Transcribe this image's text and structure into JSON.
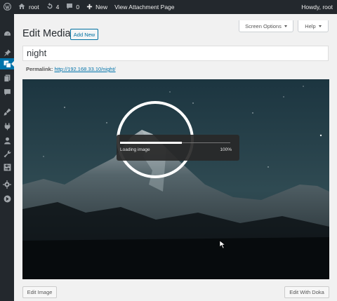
{
  "adminbar": {
    "site_name": "root",
    "updates_count": "4",
    "comments_count": "0",
    "new_label": "New",
    "view_label": "View Attachment Page",
    "howdy": "Howdy, root"
  },
  "header": {
    "title": "Edit Media",
    "add_new_label": "Add New",
    "screen_options_label": "Screen Options",
    "help_label": "Help"
  },
  "post": {
    "title_value": "night",
    "permalink_label": "Permalink:",
    "permalink_url": "http://192.168.33.10/night/"
  },
  "loader": {
    "text": "Loading image",
    "percent_label": "100%",
    "progress": 0.56
  },
  "footer": {
    "edit_image_label": "Edit Image",
    "edit_doka_label": "Edit With Doka"
  },
  "colors": {
    "admin_bar": "#23282d",
    "accent": "#0073aa",
    "background": "#f1f1f1"
  }
}
